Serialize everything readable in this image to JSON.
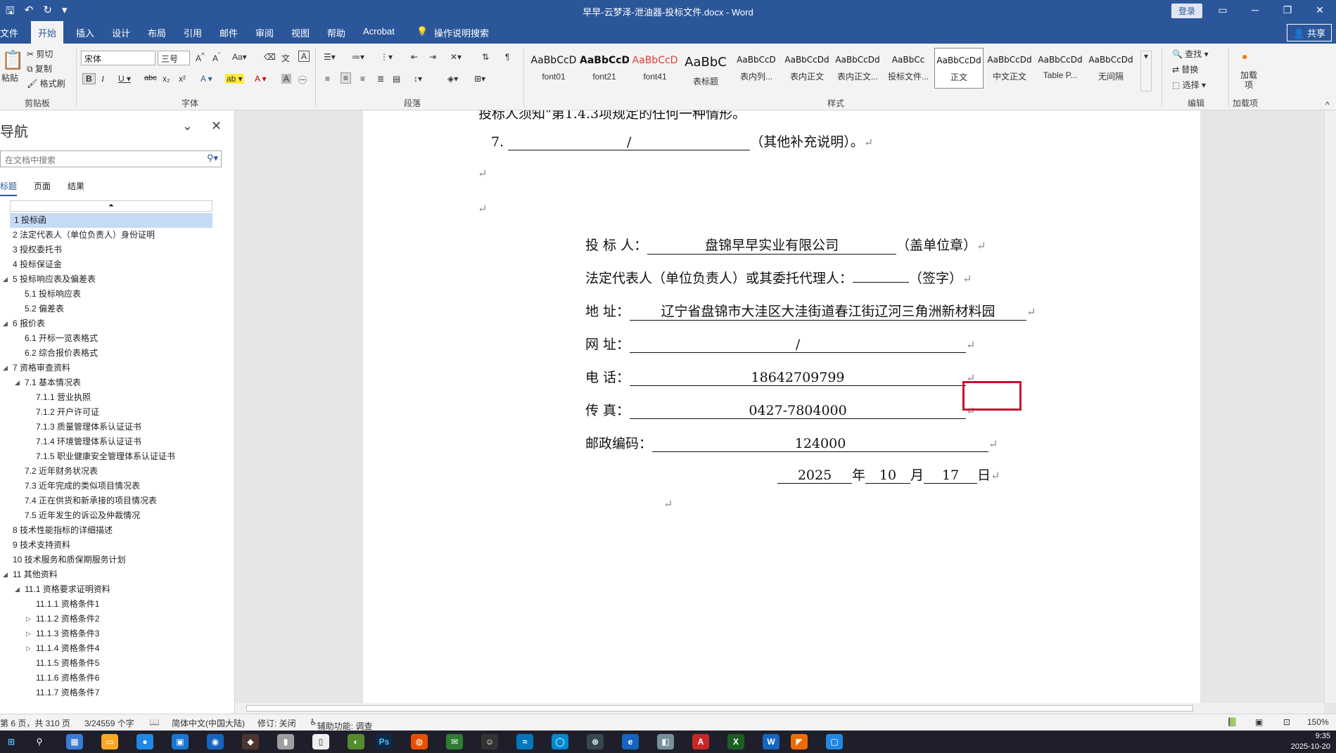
{
  "app": {
    "title": "早早-云梦泽-泄油器-投标文件.docx  -  Word",
    "login": "登录",
    "share": "共享"
  },
  "tabs": [
    "文件",
    "开始",
    "插入",
    "设计",
    "布局",
    "引用",
    "邮件",
    "审阅",
    "视图",
    "帮助",
    "Acrobat",
    "操作说明搜索"
  ],
  "ribbon": {
    "clipboard": {
      "paste": "粘贴",
      "cut": "剪切",
      "copy": "复制",
      "format_painter": "格式刷",
      "label": "剪贴板"
    },
    "font": {
      "name": "宋体",
      "size": "三号",
      "label": "字体"
    },
    "paragraph": {
      "label": "段落"
    },
    "styles": {
      "label": "样式",
      "items": [
        {
          "preview": "AaBbCcD",
          "name": "font01"
        },
        {
          "preview": "AaBbCcD",
          "name": "font21"
        },
        {
          "preview": "AaBbCcD",
          "name": "font41"
        },
        {
          "preview": "AaBbC",
          "name": "表标题"
        },
        {
          "preview": "AaBbCcD",
          "name": "表内列..."
        },
        {
          "preview": "AaBbCcDd",
          "name": "表内正文"
        },
        {
          "preview": "AaBbCcDd",
          "name": "表内正文..."
        },
        {
          "preview": "AaBbCc",
          "name": "投标文件..."
        },
        {
          "preview": "AaBbCcDd",
          "name": "正文"
        },
        {
          "preview": "AaBbCcDd",
          "name": "中文正文"
        },
        {
          "preview": "AaBbCcDd",
          "name": "Table P..."
        },
        {
          "preview": "AaBbCcDd",
          "name": "无间隔"
        }
      ]
    },
    "editing": {
      "find": "查找",
      "replace": "替换",
      "select": "选择",
      "label": "编辑"
    },
    "addins": {
      "btn": "加载项",
      "label": "加载项"
    }
  },
  "nav": {
    "title": "导航",
    "search_placeholder": "在文档中搜索",
    "tabs": [
      "标题",
      "页面",
      "结果"
    ],
    "items": [
      {
        "text": "1 投标函",
        "level": 0,
        "selected": true
      },
      {
        "text": "2 法定代表人（单位负责人）身份证明",
        "level": 0
      },
      {
        "text": "3 授权委托书",
        "level": 0
      },
      {
        "text": "4 投标保证金",
        "level": 0
      },
      {
        "text": "5 投标响应表及偏差表",
        "level": 0,
        "caret": "down"
      },
      {
        "text": "5.1 投标响应表",
        "level": 1
      },
      {
        "text": "5.2 偏差表",
        "level": 1
      },
      {
        "text": "6 报价表",
        "level": 0,
        "caret": "down"
      },
      {
        "text": "6.1 开标一览表格式",
        "level": 1
      },
      {
        "text": "6.2 综合报价表格式",
        "level": 1
      },
      {
        "text": "7 资格审查资料",
        "level": 0,
        "caret": "down"
      },
      {
        "text": "7.1 基本情况表",
        "level": 1,
        "caret": "down"
      },
      {
        "text": "7.1.1 营业执照",
        "level": 2
      },
      {
        "text": "7.1.2 开户许可证",
        "level": 2
      },
      {
        "text": "7.1.3 质量管理体系认证证书",
        "level": 2
      },
      {
        "text": "7.1.4 环境管理体系认证证书",
        "level": 2
      },
      {
        "text": "7.1.5 职业健康安全管理体系认证证书",
        "level": 2
      },
      {
        "text": "7.2 近年财务状况表",
        "level": 1
      },
      {
        "text": "7.3 近年完成的类似项目情况表",
        "level": 1
      },
      {
        "text": "7.4 正在供货和新承接的项目情况表",
        "level": 1
      },
      {
        "text": "7.5 近年发生的诉讼及仲裁情况",
        "level": 1
      },
      {
        "text": "8 技术性能指标的详细描述",
        "level": 0
      },
      {
        "text": "9 技术支持资料",
        "level": 0
      },
      {
        "text": "10 技术服务和质保期服务计划",
        "level": 0
      },
      {
        "text": "11 其他资料",
        "level": 0,
        "caret": "down"
      },
      {
        "text": "11.1 资格要求证明资料",
        "level": 1,
        "caret": "down"
      },
      {
        "text": "11.1.1 资格条件1",
        "level": 2
      },
      {
        "text": "11.1.2 资格条件2",
        "level": 2,
        "caret": "right"
      },
      {
        "text": "11.1.3 资格条件3",
        "level": 2,
        "caret": "right"
      },
      {
        "text": "11.1.4 资格条件4",
        "level": 2,
        "caret": "right"
      },
      {
        "text": "11.1.5 资格条件5",
        "level": 2
      },
      {
        "text": "11.1.6 资格条件6",
        "level": 2
      },
      {
        "text": "11.1.7 资格条件7",
        "level": 2
      }
    ]
  },
  "document": {
    "top_partial": "投标人须知\"第1.4.3项规定的任何一种情形。",
    "item7": {
      "num": "7.",
      "blank": "/",
      "suffix": "（其他补充说明）。"
    },
    "bidder": {
      "label": "投  标  人：",
      "value": "盘锦早早实业有限公司",
      "suffix": "（盖单位章）"
    },
    "legal_rep": {
      "label": "法定代表人（单位负责人）或其委托代理人：",
      "value": "",
      "suffix": "（签字）"
    },
    "address": {
      "label": "地      址：",
      "value": "辽宁省盘锦市大洼区大洼街道春江街辽河三角洲新材料园"
    },
    "website": {
      "label": "网      址：",
      "value": "/"
    },
    "phone": {
      "label": "电      话：",
      "value": "18642709799"
    },
    "fax": {
      "label": "传      真：",
      "value": "0427-7804000"
    },
    "postcode": {
      "label": "邮政编码：",
      "value": "124000"
    },
    "date": {
      "year": "2025",
      "year_unit": "年",
      "month": "10",
      "month_unit": "月",
      "day": "17",
      "day_unit": "日"
    },
    "para_mark": "↵"
  },
  "status": {
    "page": "第 6 页，共 310 页",
    "words": "3/24559 个字",
    "language": "简体中文(中国大陆)",
    "track": "修订: 关闭",
    "accessibility": "辅助功能: 调查",
    "zoom": "150%"
  },
  "taskbar": {
    "time": "9:35",
    "date": "2025-10-20"
  }
}
